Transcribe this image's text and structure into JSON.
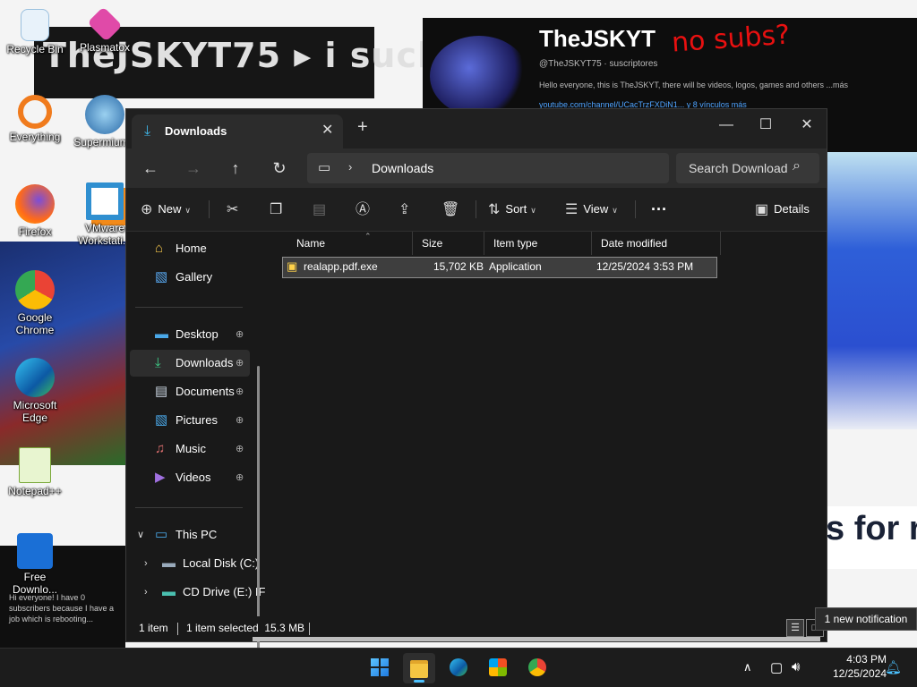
{
  "desktop": {
    "banner_text": "TheJSKYT75 ▸ i suck",
    "channel": {
      "name": "TheJSKYT",
      "handle": "@TheJSKYT75 · suscriptores",
      "doodle": "no subs?",
      "description": "Hello everyone, this is TheJSKYT, there will be videos, logos, games and others ...más",
      "link": "youtube.com/channel/UCacTrzFXDiN1... y 8 vínculos más"
    },
    "right_text": "s for r",
    "bottom_left_text": "Hi everyone! I have 0 subscribers because I have a job which is rebooting...",
    "icons": [
      {
        "label": "Recycle Bin"
      },
      {
        "label": "Plasmatox"
      },
      {
        "label": "Everything"
      },
      {
        "label": "SupermiumB"
      },
      {
        "label": "Firefox"
      },
      {
        "label": "VMware Workstati..."
      },
      {
        "label": "Google Chrome"
      },
      {
        "label": "Microsoft Edge"
      },
      {
        "label": "Notepad++"
      },
      {
        "label": "Free Downlo..."
      }
    ]
  },
  "explorer": {
    "tab_title": "Downloads",
    "address": "Downloads",
    "search_placeholder": "Search Downloads",
    "toolbar": {
      "new": "New",
      "sort": "Sort",
      "view": "View",
      "more": "···",
      "details": "Details"
    },
    "nav": {
      "home": "Home",
      "gallery": "Gallery",
      "desktop": "Desktop",
      "downloads": "Downloads",
      "documents": "Documents",
      "pictures": "Pictures",
      "music": "Music",
      "videos": "Videos",
      "this_pc": "This PC",
      "local_disk": "Local Disk (C:)",
      "cd_drive": "CD Drive (E:) IF"
    },
    "columns": [
      "Name",
      "Size",
      "Item type",
      "Date modified"
    ],
    "files": [
      {
        "name": "realapp.pdf.exe",
        "size": "15,702 KB",
        "type": "Application",
        "date": "12/25/2024 3:53 PM"
      }
    ],
    "status": {
      "count": "1 item",
      "selected": "1 item selected  15.3 MB"
    }
  },
  "notification": "1 new notification",
  "taskbar": {
    "time": "4:03 PM",
    "date": "12/25/2024"
  }
}
